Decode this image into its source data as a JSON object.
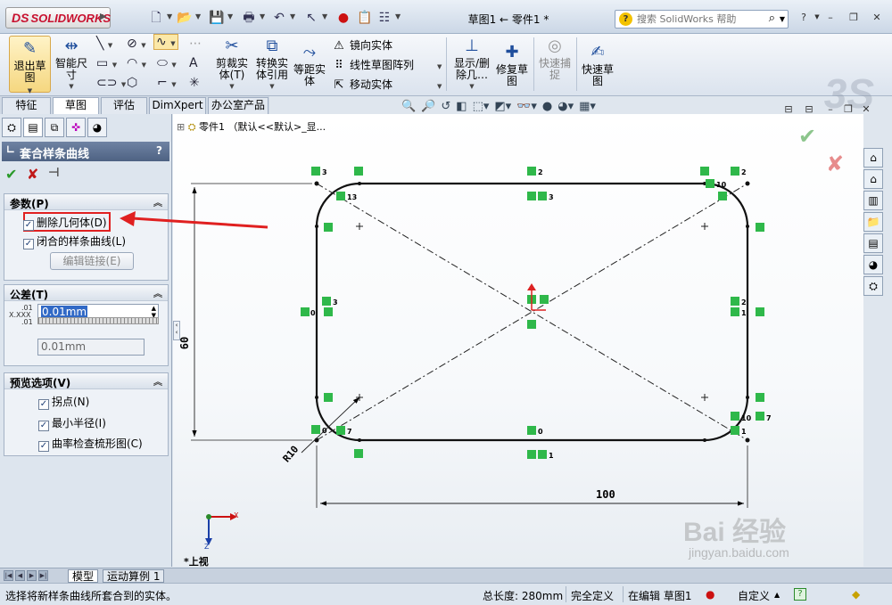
{
  "app": {
    "logo_text": "SOLIDWORKS",
    "logo_mark": "DS",
    "doc_title": "草图1 ← 零件1 *",
    "help_search_placeholder": "搜索 SolidWorks 帮助"
  },
  "toolbar": {
    "exit_sketch": "退出草\n图",
    "smart_dim": "智能尺\n寸",
    "trim": "剪裁实\n体(T)",
    "convert": "转换实\n体引用",
    "offset": "等距实\n体",
    "mirror": "镜向实体",
    "linear_pattern": "线性草图阵列",
    "move": "移动实体",
    "show_delete": "显示/删\n除几…",
    "repair": "修复草\n图",
    "quick_snap": "快速捕\n捉",
    "rapid_sketch": "快速草\n图"
  },
  "cm_tabs": [
    "特征",
    "草图",
    "评估",
    "DimXpert",
    "办公室产品"
  ],
  "tree_flyout": "零件1 （默认<<默认>_显...",
  "property_manager": {
    "title": "套合样条曲线",
    "help": "?",
    "params": {
      "header": "参数(P)",
      "delete_geometry": "删除几何体(D)",
      "closed_spline": "闭合的样条曲线(L)",
      "edit_link": "编辑链接(E)"
    },
    "tolerance": {
      "header": "公差(T)",
      "value": "0.01mm",
      "value2": "0.01mm",
      "icon_top": ".01",
      "icon_mid": "X.XXX",
      "icon_bot": ".01"
    },
    "preview": {
      "header": "预览选项(V)",
      "inflection": "拐点(N)",
      "min_radius": "最小半径(I)",
      "curvature_comb": "曲率检查梳形图(C)"
    }
  },
  "sketch": {
    "dim_height": "60",
    "dim_width": "100",
    "dim_radius": "R10",
    "relations": [
      "3",
      "2",
      "13",
      "3",
      "10",
      "2",
      "3",
      "0",
      "1",
      "2",
      "1",
      "13",
      "10",
      "7",
      "1",
      "7",
      "0",
      "0",
      "1"
    ],
    "view_label": "*上视",
    "axis_x": "X",
    "axis_z": "Z"
  },
  "bottom_tabs": [
    "模型",
    "运动算例 1"
  ],
  "status": {
    "message": "选择将新样条曲线所套合到的实体。",
    "total_length": "总长度: 280mm",
    "defined": "完全定义",
    "editing": "在编辑 草图1",
    "units": "自定义",
    "help": "?"
  },
  "watermark": {
    "brand": "Bai 经验",
    "url": "jingyan.baidu.com"
  },
  "colors": {
    "accent_red": "#e02020",
    "relation_green": "#2fb84a",
    "title_blue": "#4e6283"
  }
}
